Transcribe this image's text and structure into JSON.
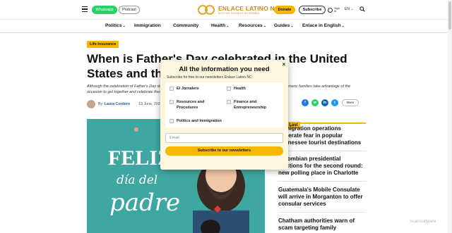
{
  "header": {
    "whatsapp_label": "Whatsapp",
    "podcast_label": "Podcast",
    "logo_brand": "ENLACE LATINO NC",
    "logo_tagline": "NOTICIAS DIGITALES EN ESPAÑOL",
    "donate_label": "Donate",
    "subscribe_label": "Subscribe",
    "signin_label": "Sign in",
    "language": "EN",
    "language_chevron": "⌄"
  },
  "nav": {
    "items": [
      {
        "label": "Politics",
        "chevron": "⌄"
      },
      {
        "label": "Immigration",
        "chevron": ""
      },
      {
        "label": "Community",
        "chevron": ""
      },
      {
        "label": "Health",
        "chevron": "⌄"
      },
      {
        "label": "Resources",
        "chevron": "⌄"
      },
      {
        "label": "Guides",
        "chevron": "⌄"
      },
      {
        "label": "Enlace in English",
        "chevron": "⌄"
      }
    ]
  },
  "article": {
    "category": "Life Insurance",
    "headline": "When is Father's Day celebrated in the United States and the rest of the world?",
    "lede": "Although the celebration of Father's Day does not have a fixed date in all countries, as is the case with Mother's Day, many families take advantage of the occasion to get together and celebrate those men who have been a fundamental pillar: parents and grandparents",
    "byline_prefix": "By:",
    "author": "Laura Cordero",
    "date": "13 June, 2024",
    "more_label": "More",
    "hero_text_1": "FELIZ",
    "hero_text_2": "día del",
    "hero_text_3": "padre"
  },
  "sidebar": {
    "header": "The Last",
    "items": [
      {
        "title": "Immigration operations generate fear in popular Tennessee tourist destinations"
      },
      {
        "title": "Colombian presidential elections for the second round: new polling place in Charlotte"
      },
      {
        "title": "Guatemala's Mobile Consulate will arrive in Morganton to offer consular services"
      },
      {
        "title": "Chatham authorities warn of scam targeting family"
      }
    ]
  },
  "modal": {
    "title": "All the information you need",
    "subtitle": "Subscribe for free to our newsletters Enlace Latino NC:",
    "options": [
      {
        "label": "El Jornalero"
      },
      {
        "label": "Health"
      },
      {
        "label": "Resources and Procedures"
      },
      {
        "label": "Finance and Entrepreneurship"
      },
      {
        "label": "Politics and Immigration"
      }
    ],
    "email_placeholder": "Email",
    "submit_label": "Subscribe to our newsletters",
    "close_symbol": "×"
  },
  "watermark": "ScanSoftware",
  "colors": {
    "accent": "#f5b700",
    "brand": "#c98d15",
    "whatsapp": "#25d366",
    "link": "#1a5fa8",
    "hero_bg": "#3fa7a1",
    "modal_bg": "#fdf6df"
  }
}
